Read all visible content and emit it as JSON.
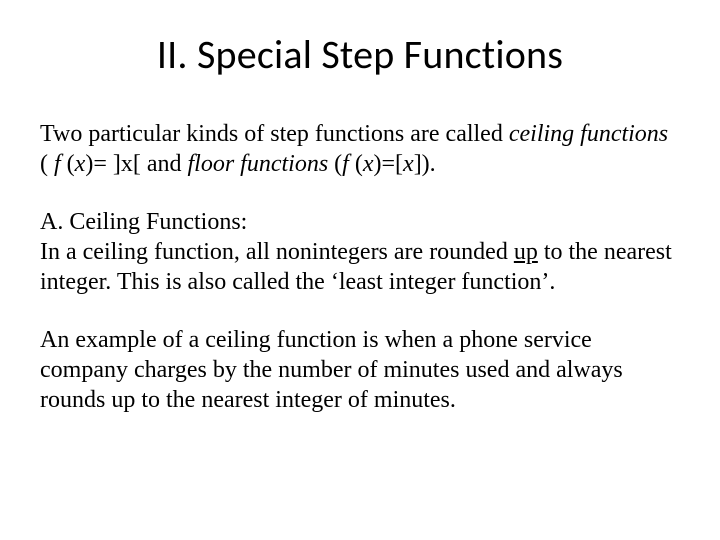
{
  "title": "II. Special Step Functions",
  "intro": {
    "lead1": "Two particular kinds of step functions are called ",
    "ceiling_term": "ceiling functions",
    "lead2": " ( ",
    "f1": "f ",
    "paren1": "(",
    "x1": "x",
    "paren_close1": ")= ]x[ and ",
    "floor_term": "floor functions",
    "space1": " (",
    "f2": "f ",
    "paren2": "(",
    "x2": "x",
    "tail": ")=[",
    "x3": "x",
    "end": "])."
  },
  "sectionA": {
    "heading": "A.  Ceiling Functions:",
    "line1a": "In a ceiling function, all nonintegers are rounded ",
    "up": "up",
    "line1b": " to the nearest integer. This is also called the ‘least integer function’."
  },
  "example": "An example of a ceiling function is when a phone service company charges by the number of minutes used and always rounds up to the nearest integer of minutes."
}
